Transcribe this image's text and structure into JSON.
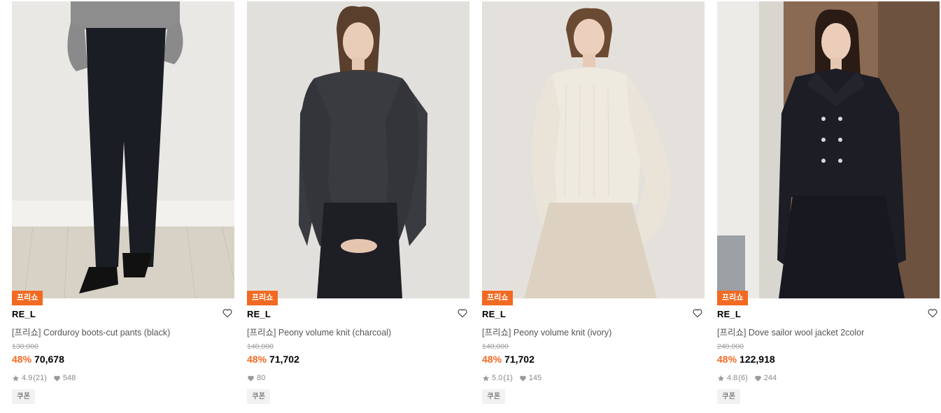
{
  "products": [
    {
      "badge": "프리쇼",
      "brand": "RE_L",
      "title": "[프리쇼] Corduroy boots-cut pants (black)",
      "original_price": "138,000",
      "discount": "48%",
      "sale_price": "70,678",
      "rating": "4.9",
      "review_count": "(21)",
      "likes": "548",
      "coupon": "쿠폰",
      "icons": {
        "wish": "heart-outline-icon",
        "rating": "star-icon",
        "likes": "heart-icon"
      }
    },
    {
      "badge": "프리쇼",
      "brand": "RE_L",
      "title": "[프리쇼] Peony volume knit (charcoal)",
      "original_price": "140,000",
      "discount": "48%",
      "sale_price": "71,702",
      "rating": "",
      "review_count": "",
      "likes": "80",
      "coupon": "쿠폰",
      "icons": {
        "wish": "heart-outline-icon",
        "likes": "heart-icon"
      }
    },
    {
      "badge": "프리쇼",
      "brand": "RE_L",
      "title": "[프리쇼] Peony volume knit (ivory)",
      "original_price": "140,000",
      "discount": "48%",
      "sale_price": "71,702",
      "rating": "5.0",
      "review_count": "(1)",
      "likes": "145",
      "coupon": "쿠폰",
      "icons": {
        "wish": "heart-outline-icon",
        "rating": "star-icon",
        "likes": "heart-icon"
      }
    },
    {
      "badge": "프리쇼",
      "brand": "RE_L",
      "title": "[프리쇼] Dove sailor wool jacket 2color",
      "original_price": "240,000",
      "discount": "48%",
      "sale_price": "122,918",
      "rating": "4.8",
      "review_count": "(6)",
      "likes": "244",
      "coupon": "쿠폰",
      "icons": {
        "wish": "heart-outline-icon",
        "rating": "star-icon",
        "likes": "heart-icon"
      }
    }
  ],
  "colors": {
    "accent": "#f26a21",
    "muted": "#a0a0a0",
    "meta": "#8a8a8a"
  }
}
